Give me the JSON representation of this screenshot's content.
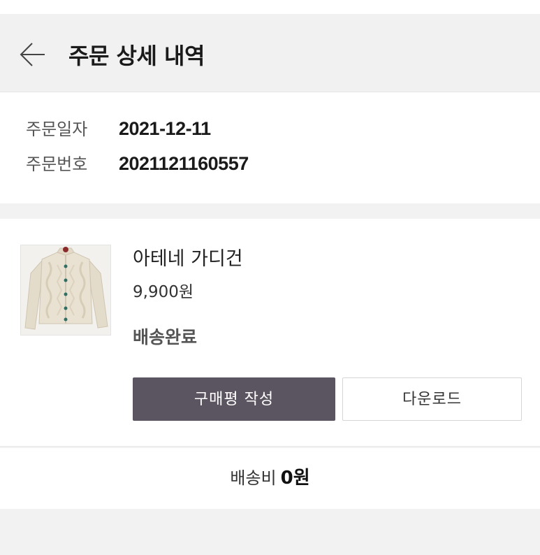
{
  "header": {
    "title": "주문 상세 내역",
    "back_icon": "arrow-left-icon"
  },
  "order": {
    "date_label": "주문일자",
    "date_value": "2021-12-11",
    "number_label": "주문번호",
    "number_value": "2021121160557"
  },
  "product": {
    "image_icon": "cardigan-thumbnail",
    "name": "아테네 가디건",
    "price": "9,900원",
    "status": "배송완료",
    "review_button": "구매평 작성",
    "download_button": "다운로드"
  },
  "shipping": {
    "label": "배송비",
    "value": "0원"
  },
  "colors": {
    "review_button_bg": "#5b5561",
    "header_bg": "#f1f1f1",
    "page_bg": "#f2f2f2"
  }
}
